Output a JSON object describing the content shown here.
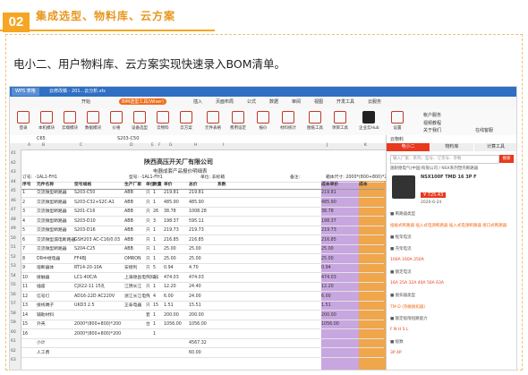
{
  "section": {
    "number": "02",
    "title": "集成选型、物料库、云方案"
  },
  "description": "电小二、用户物料库、云方案实现快速录入BOM清单。",
  "app": {
    "tabs": [
      "WPS 表格",
      "云修改稿 - 201...云分析.xls"
    ],
    "menus": [
      "开始",
      "插入",
      "页面布局",
      "公式",
      "数据",
      "审阅",
      "视图",
      "开发工具",
      "云服务"
    ],
    "menu_highlight": "BIM选型工具(Wiser)",
    "ribbon": [
      "登录",
      "本机模块",
      "云端模块",
      "数据模块",
      "价格",
      "设备选型",
      "云物料",
      "云方案",
      "元件表格",
      "费用设定",
      "报价",
      "材料统计",
      "图纸工具",
      "项目工具",
      "企业云Hub",
      "设置"
    ],
    "right_menu": [
      "帐户服务",
      "视频教程",
      "关于我们",
      "在线客服"
    ],
    "cell_ref": "C65",
    "formula": "S203-C50"
  },
  "sheet": {
    "title": "陕西高压开关厂有限公司",
    "subtitle": "电器成套产品报价明细表",
    "meta": [
      "订号:",
      "-1AL1-FH1",
      "型号: -1AL1-FH1",
      "单位: 非标箱",
      "备注:",
      "箱体尺寸: 2000*(800+800)*200"
    ],
    "columns": [
      "序号",
      "元件名称",
      "型号规格",
      "生产厂家",
      "单位",
      "数量",
      "单价",
      "总价",
      "系数",
      "成本单价",
      "成本"
    ],
    "col_letters": [
      "A",
      "B",
      "C",
      "D",
      "E",
      "F",
      "G",
      "H",
      "I",
      "J",
      "K"
    ],
    "row_numbers": [
      "41",
      "42",
      "43",
      "44",
      "45",
      "46",
      "47",
      "48",
      "49",
      "50",
      "51",
      "52",
      "53",
      "54",
      "55",
      "56",
      "57",
      "58",
      "59",
      "60",
      "61",
      "62",
      "63"
    ],
    "rows": [
      [
        "1",
        "交流微型断路器",
        "S203-C50",
        "ABB",
        "只",
        "1",
        "219.81",
        "219.81",
        "",
        "219.81",
        ""
      ],
      [
        "2",
        "交流微型断路器",
        "S203-C32+S2C-A1",
        "ABB",
        "只",
        "1",
        "485.90",
        "485.90",
        "",
        "485.90",
        ""
      ],
      [
        "3",
        "交流微型断路器",
        "S201-C16",
        "ABB",
        "只",
        "26",
        "38.78",
        "1008.28",
        "",
        "38.78",
        ""
      ],
      [
        "4",
        "交流微型断路器",
        "S203-D10",
        "ABB",
        "只",
        "3",
        "198.37",
        "595.11",
        "",
        "198.37",
        ""
      ],
      [
        "5",
        "交流微型断路器",
        "S203-D16",
        "ABB",
        "只",
        "1",
        "219.73",
        "219.73",
        "",
        "219.73",
        ""
      ],
      [
        "6",
        "交流微型漏电断路器",
        "GSH203 AC-C16/0.03",
        "ABB",
        "只",
        "1",
        "216.85",
        "216.85",
        "",
        "216.85",
        ""
      ],
      [
        "7",
        "交流微型断路器",
        "S204-C25",
        "ABB",
        "只",
        "1",
        "25.00",
        "25.00",
        "",
        "25.00",
        ""
      ],
      [
        "8",
        "DR中继电器",
        "FF4BJ",
        "OMRON",
        "只",
        "1",
        "25.00",
        "25.00",
        "",
        "25.00",
        ""
      ],
      [
        "9",
        "熔断器体",
        "RT14-20-10A",
        "安德利",
        "只",
        "5",
        "0.94",
        "4.70",
        "",
        "0.94",
        ""
      ],
      [
        "10",
        "接触器",
        "LC1-40C/A",
        "上海德昌电气科技",
        "只",
        "1",
        "474.03",
        "474.03",
        "",
        "474.03",
        ""
      ],
      [
        "11",
        "插座",
        "CJX22-11 15孔",
        "江阴长江",
        "只",
        "1",
        "12.20",
        "24.40",
        "",
        "12.20",
        ""
      ],
      [
        "12",
        "信号灯",
        "AD16-22D AC220V",
        "浙江长江电气",
        "只",
        "4",
        "6.00",
        "24.00",
        "",
        "6.00",
        ""
      ],
      [
        "13",
        "接线端子",
        "UKD3 2.5",
        "正泰电器",
        "只",
        "15",
        "1.51",
        "15.51",
        "",
        "1.51",
        ""
      ],
      [
        "14",
        "辅助材料",
        "",
        "",
        "套",
        "1",
        "200.00",
        "200.00",
        "",
        "200.00",
        ""
      ],
      [
        "15",
        "外壳",
        "2000*(800+800)*200",
        "",
        "台",
        "1",
        "1056.00",
        "1056.00",
        "",
        "1056.00",
        ""
      ],
      [
        "16",
        "",
        "2000*(800+800)*200",
        "",
        "",
        "1",
        "",
        "",
        "",
        "",
        ""
      ],
      [
        "",
        "小计",
        "",
        "",
        "",
        "",
        "",
        "4567.32",
        "",
        "",
        ""
      ],
      [
        "",
        "人工费",
        "",
        "",
        "",
        "",
        "",
        "60.00",
        "",
        "",
        ""
      ]
    ]
  },
  "panel": {
    "header": "云物料",
    "tabs": [
      "电小二",
      "物料库",
      "计算工具"
    ],
    "search_placeholder": "输入厂家、系列、型号、订货号、参数",
    "search_button": "搜索",
    "filter": "施耐德电气(中国)有限公司 / NSX系列塑壳断路器",
    "product_name": "NSX100F TMD 16 3P F",
    "price": "¥ 725.43",
    "date": "2020-6-24",
    "lines": [
      {
        "text": "■ 断路器类型",
        "cls": ""
      },
      {
        "text": "插拔式断路器  插入式电源断路器  插入式电源断路器  接口式断路器",
        "cls": "or"
      },
      {
        "text": "■ 框架电流",
        "cls": ""
      },
      {
        "text": "■ 壳架电流",
        "cls": ""
      },
      {
        "text": "100A  160A  250A",
        "cls": "red"
      },
      {
        "text": "■ 额定电流",
        "cls": ""
      },
      {
        "text": "16A  25A  32A  40A  50A  63A",
        "cls": "red"
      },
      {
        "text": "■ 脱扣器类型",
        "cls": ""
      },
      {
        "text": "TM-D (热磁脱扣器)",
        "cls": "or"
      },
      {
        "text": "■ 额定极限短路能力",
        "cls": ""
      },
      {
        "text": "F  N  H  S  L",
        "cls": "red"
      },
      {
        "text": "■ 极数",
        "cls": ""
      },
      {
        "text": "3P  4P",
        "cls": "red"
      }
    ]
  }
}
